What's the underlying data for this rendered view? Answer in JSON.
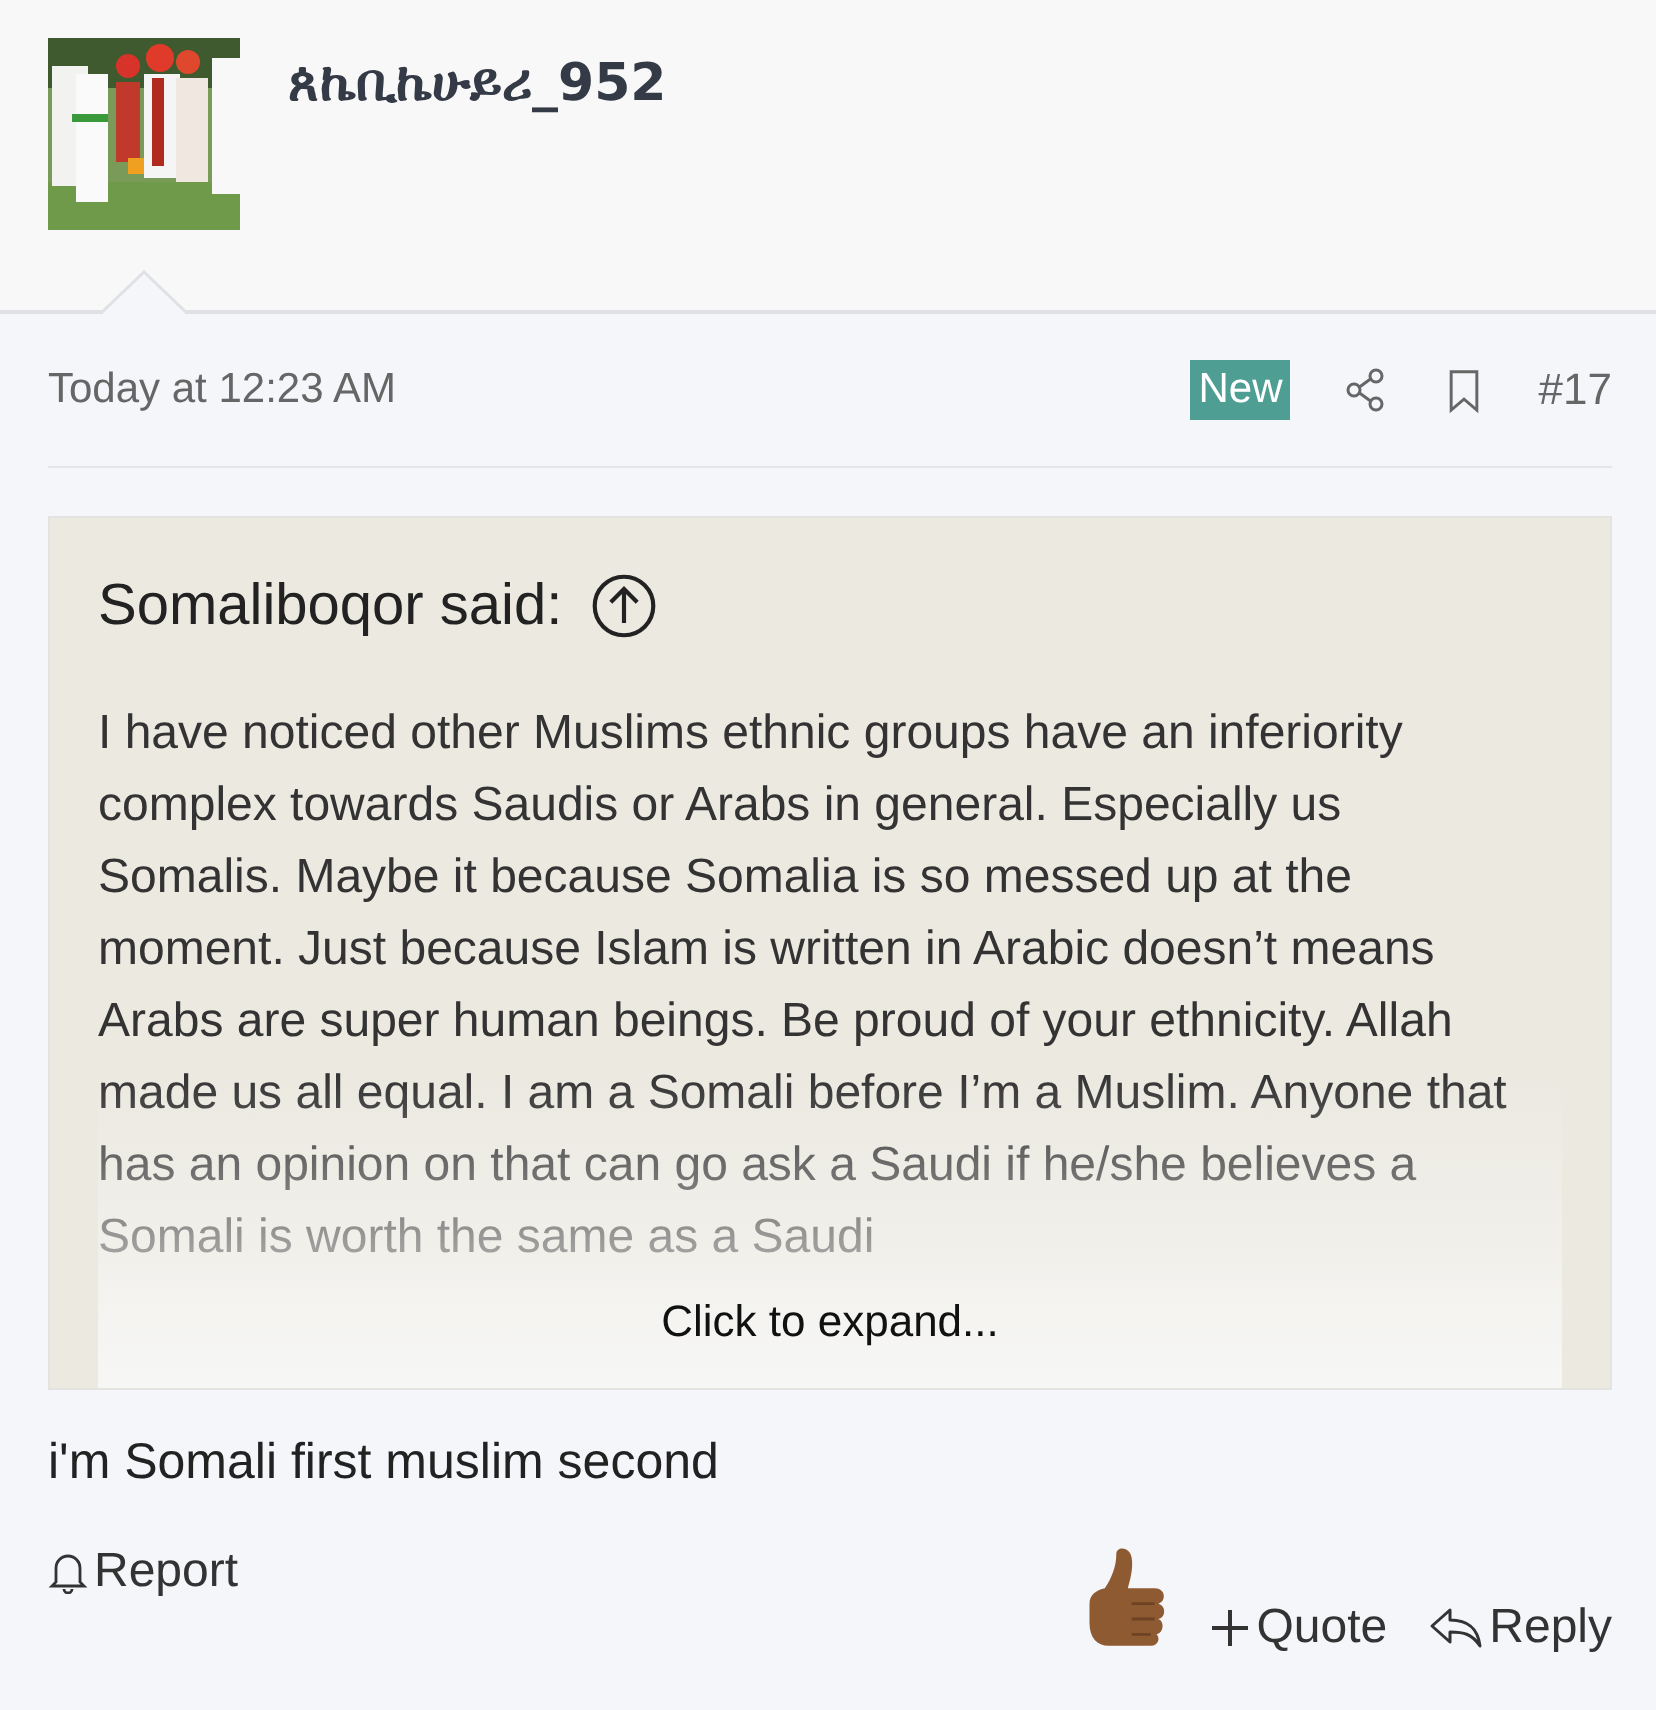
{
  "user": {
    "name": "ጰኬቢኬሁይሪ_952"
  },
  "post": {
    "time": "Today at 12:23 AM",
    "badge": "New",
    "number": "#17"
  },
  "quote": {
    "author": "Somaliboqor said:",
    "text": "I have noticed other Muslims ethnic groups have an inferiority complex towards Saudis or Arabs in general. Especially us Somalis. Maybe it because Somalia is so messed up at the moment. Just because Islam is written in Arabic doesn’t means Arabs are super human beings. Be proud of your ethnicity. Allah made us all equal. I am a Somali before I’m a Muslim. Anyone that has an opinion on that can go ask a Saudi if he/she believes a Somali is worth the same as a Saudi",
    "expand": "Click to expand..."
  },
  "message": "i'm Somali first muslim second",
  "actions": {
    "report": "Report",
    "quote": "Quote",
    "reply": "Reply"
  }
}
